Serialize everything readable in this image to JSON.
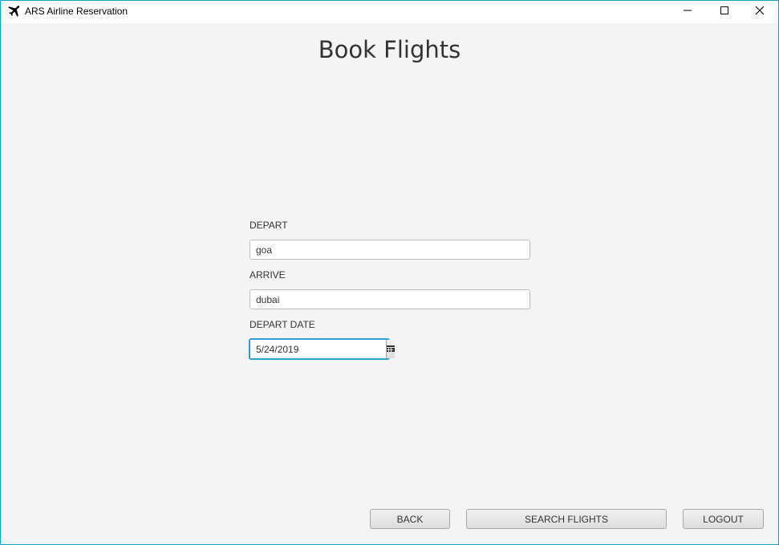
{
  "window": {
    "title": "ARS Airline Reservation"
  },
  "page": {
    "title": "Book Flights"
  },
  "form": {
    "depart_label": "DEPART",
    "depart_value": "goa",
    "arrive_label": "ARRIVE",
    "arrive_value": "dubai",
    "date_label": "DEPART DATE",
    "date_value": "5/24/2019"
  },
  "buttons": {
    "back": "BACK",
    "search": "SEARCH FLIGHTS",
    "logout": "LOGOUT"
  },
  "icons": {
    "app": "airplane-icon",
    "minimize": "minimize-icon",
    "maximize": "maximize-icon",
    "close": "close-icon",
    "calendar": "calendar-icon"
  },
  "colors": {
    "focus_border": "#2a9fd6",
    "window_border": "#1aa0c8"
  }
}
